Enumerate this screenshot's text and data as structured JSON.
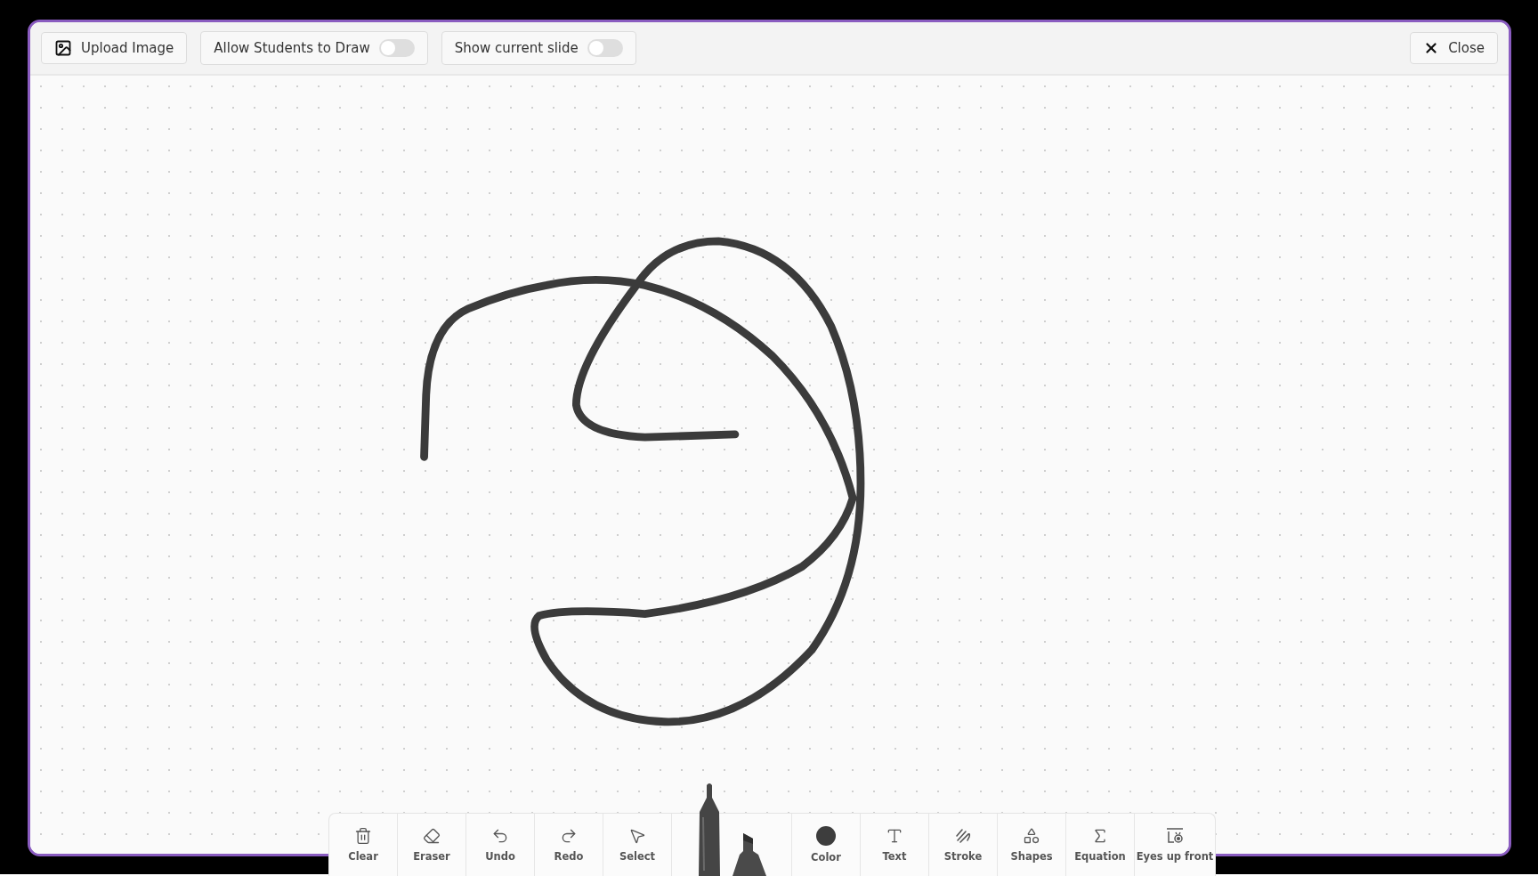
{
  "top_bar": {
    "upload_button": {
      "label": "Upload Image"
    },
    "toggles": [
      {
        "label": "Allow Students to Draw",
        "on": false
      },
      {
        "label": "Show current slide",
        "on": false
      }
    ],
    "close_button": {
      "label": "Close"
    }
  },
  "toolbar": {
    "tools": [
      {
        "kind": "button",
        "label": "Clear"
      },
      {
        "kind": "button",
        "label": "Eraser"
      },
      {
        "kind": "button",
        "label": "Undo"
      },
      {
        "kind": "button",
        "label": "Redo"
      },
      {
        "kind": "button",
        "label": "Select"
      },
      {
        "kind": "pens",
        "pens": [
          {
            "kind": "pen",
            "selected": true
          },
          {
            "kind": "marker",
            "selected": false
          }
        ]
      },
      {
        "kind": "color",
        "label": "Color",
        "color": "#3d3d3d"
      },
      {
        "kind": "button",
        "label": "Text"
      },
      {
        "kind": "button",
        "label": "Stroke"
      },
      {
        "kind": "button",
        "label": "Shapes"
      },
      {
        "kind": "button",
        "label": "Equation"
      },
      {
        "kind": "button",
        "label": "Eyes up front"
      }
    ]
  }
}
